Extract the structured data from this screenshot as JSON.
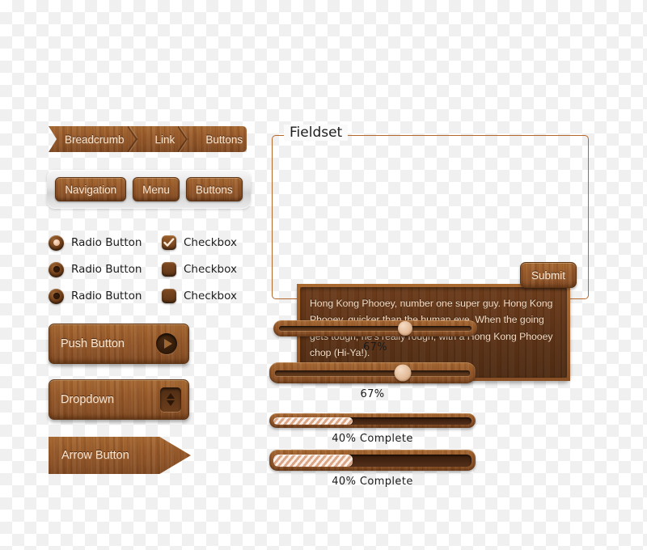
{
  "breadcrumb": {
    "items": [
      {
        "label": "Breadcrumb"
      },
      {
        "label": "Link"
      },
      {
        "label": "Buttons"
      }
    ]
  },
  "navbar": {
    "items": [
      {
        "label": "Navigation"
      },
      {
        "label": "Menu"
      },
      {
        "label": "Buttons"
      }
    ]
  },
  "controls": {
    "radios": [
      {
        "label": "Radio Button",
        "selected": true
      },
      {
        "label": "Radio Button",
        "selected": false
      },
      {
        "label": "Radio Button",
        "selected": false
      }
    ],
    "checkboxes": [
      {
        "label": "Checkbox",
        "checked": true
      },
      {
        "label": "Checkbox",
        "checked": false
      },
      {
        "label": "Checkbox",
        "checked": false
      }
    ]
  },
  "buttons": {
    "push": {
      "label": "Push Button",
      "icon": "play-triangle-icon"
    },
    "dropdown": {
      "label": "Dropdown",
      "icon": "updown-spinner-icon"
    },
    "arrow": {
      "label": "Arrow Button"
    }
  },
  "fieldset": {
    "legend": "Fieldset",
    "textarea_value": "Hong Kong Phooey, number one super guy. Hong Kong Phooey, quicker than the human eye. When the going gets tough, he's really rough, with a Hong Kong Phooey chop (Hi-Ya!).",
    "submit_label": "Submit"
  },
  "sliders": [
    {
      "name": "slider-thin",
      "value": 67,
      "value_label": "67%"
    },
    {
      "name": "slider-thick",
      "value": 67,
      "value_label": "67%"
    }
  ],
  "progress_bars": [
    {
      "name": "progress-thin",
      "value": 40,
      "value_label": "40% Complete"
    },
    {
      "name": "progress-thick",
      "value": 40,
      "value_label": "40% Complete"
    }
  ],
  "colors": {
    "wood_light": "#a86a33",
    "wood_mid": "#8e5629",
    "wood_dark": "#5b3216",
    "text_on_wood": "#fbe5cf",
    "fieldset_border": "#b5682c",
    "progress_fill": "#f0c6ab",
    "label_text": "#1c1c1c"
  }
}
